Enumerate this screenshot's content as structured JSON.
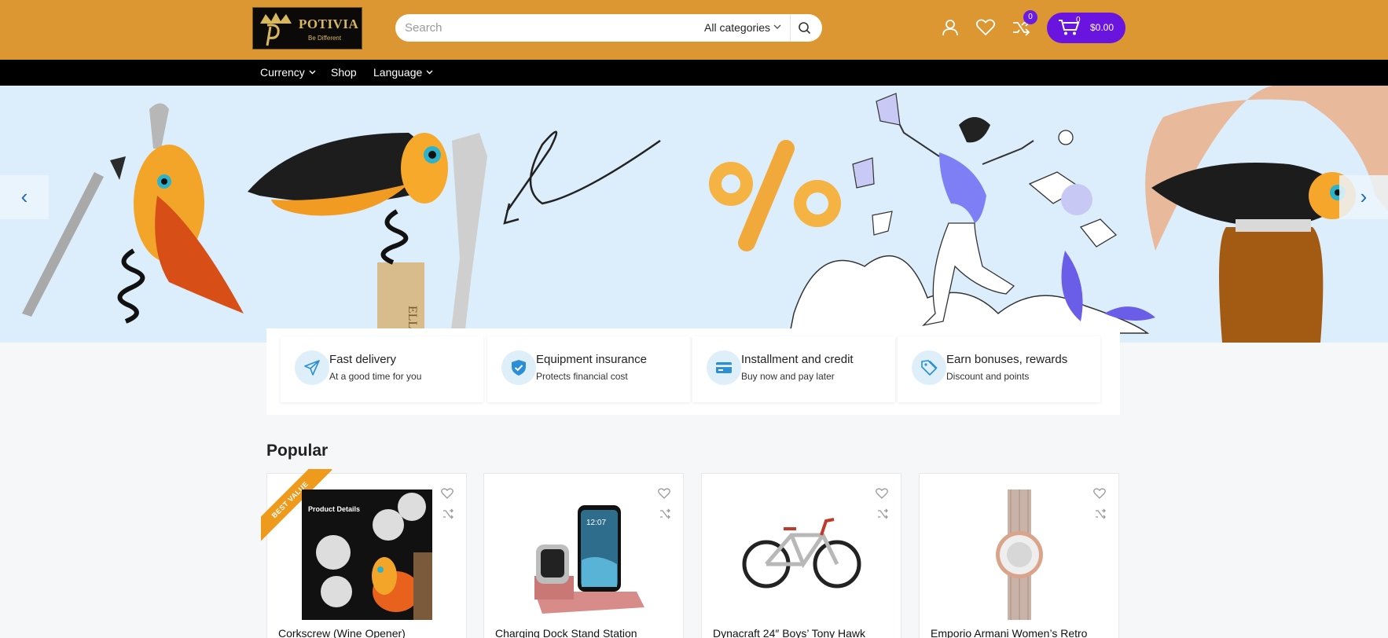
{
  "logo": {
    "brand": "POTIVIA",
    "tagline": "Be Different"
  },
  "search": {
    "placeholder": "Search",
    "category": "All categories"
  },
  "header": {
    "compare_count": "0",
    "cart_count": "0",
    "cart_total": "$0.00"
  },
  "nav": {
    "currency": "Currency",
    "shop": "Shop",
    "language": "Language"
  },
  "banner": {
    "prev": "‹",
    "next": "›",
    "cork_text": "ELLATION"
  },
  "features": [
    {
      "title": "Fast delivery",
      "subtitle": "At a good time for you",
      "icon": "paper-plane-icon"
    },
    {
      "title": "Equipment insurance",
      "subtitle": "Protects financial cost",
      "icon": "shield-check-icon"
    },
    {
      "title": "Installment and credit",
      "subtitle": "Buy now and pay later",
      "icon": "credit-card-icon"
    },
    {
      "title": "Earn bonuses, rewards",
      "subtitle": "Discount and points",
      "icon": "tag-icon"
    }
  ],
  "popular": {
    "title": "Popular",
    "products": [
      {
        "title": "Corkscrew (Wine Opener)",
        "badge": "BEST VALUE",
        "image_text": "Product Details"
      },
      {
        "title": "Charging Dock Stand Station",
        "image_text": "12:07"
      },
      {
        "title": "Dynacraft 24″ Boys’ Tony Hawk"
      },
      {
        "title": "Emporio Armani Women’s Retro"
      }
    ]
  },
  "colors": {
    "header": "#dc9733",
    "accent": "#6915df",
    "navbar": "#000000",
    "banner": "#dcedfb",
    "icon_blue": "#2a8fd6"
  }
}
